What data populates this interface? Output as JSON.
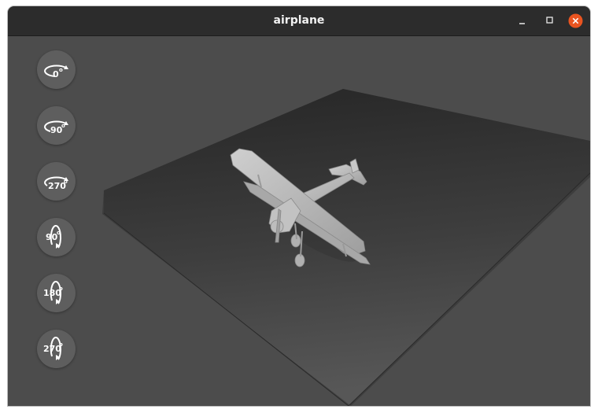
{
  "window": {
    "title": "airplane",
    "controls": {
      "minimize_icon": "minimize-icon",
      "maximize_icon": "maximize-icon",
      "close_icon": "close-icon",
      "close_color": "#e95420"
    }
  },
  "toolbar": {
    "buttons": [
      {
        "label": "0",
        "degree_symbol": "o",
        "axis": "horizontal",
        "icon": "rotate-horizontal-icon"
      },
      {
        "label": "90",
        "degree_symbol": "o",
        "axis": "horizontal",
        "icon": "rotate-horizontal-icon"
      },
      {
        "label": "270",
        "degree_symbol": "o",
        "axis": "horizontal",
        "icon": "rotate-horizontal-icon"
      },
      {
        "label": "90",
        "degree_symbol": "o",
        "axis": "vertical",
        "icon": "rotate-vertical-icon"
      },
      {
        "label": "180",
        "degree_symbol": "o",
        "axis": "vertical",
        "icon": "rotate-vertical-icon"
      },
      {
        "label": "270",
        "degree_symbol": "o",
        "axis": "vertical",
        "icon": "rotate-vertical-icon"
      }
    ]
  },
  "scene": {
    "object": "biplane-model",
    "colors": {
      "background": "#4c4c4c",
      "floor_far": "#2b2b2b",
      "floor_near": "#575757",
      "model": "#b5b5b5"
    }
  }
}
